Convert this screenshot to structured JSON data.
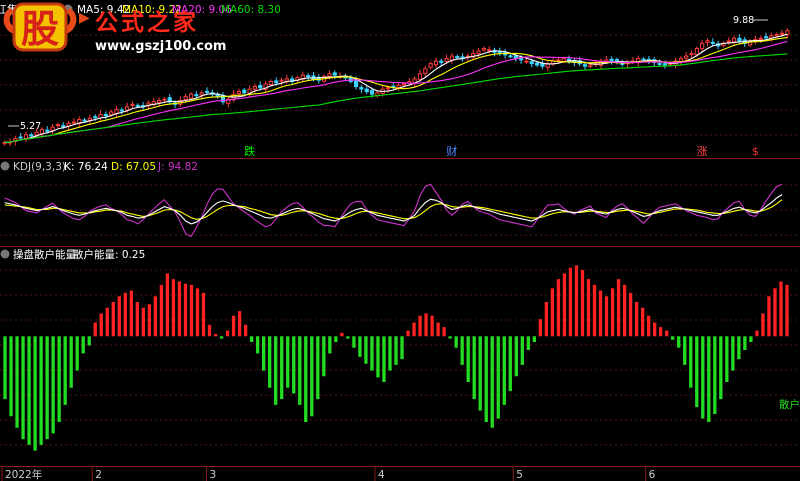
{
  "top_panel": {
    "title": "东江集团(日线)",
    "ma_labels": [
      {
        "text": "MA5: 9.42",
        "color": "#ffffff"
      },
      {
        "text": "MA10: 9.22",
        "color": "#ffff00"
      },
      {
        "text": "MA20: 9.06",
        "color": "#ff33ff"
      },
      {
        "text": "MA60: 8.30",
        "color": "#00dd00"
      }
    ],
    "high_label": "9.88",
    "low_label": "5.27",
    "signals": [
      {
        "text": "跌",
        "color": "#00ff00",
        "idx": 46
      },
      {
        "text": "财",
        "color": "#4d8cff",
        "idx": 84
      },
      {
        "text": "涨",
        "color": "#ff4444",
        "idx": 131
      },
      {
        "text": "$",
        "color": "#ff3333",
        "idx": 141
      }
    ]
  },
  "kdj_panel": {
    "title": "KDJ(9,3,3)",
    "k_label": "K: 76.24",
    "d_label": "D: 67.05",
    "j_label": "J: 94.82",
    "colors": {
      "k": "#ffffff",
      "d": "#ffff00",
      "j": "#cc33cc"
    }
  },
  "energy_panel": {
    "title": "操盘散户能量",
    "value_label": "散户能量: 0.25",
    "right_label": "散户",
    "colors": {
      "pos": "#ff2222",
      "neg": "#22dd22"
    }
  },
  "date_axis": {
    "labels": [
      {
        "text": "2022年",
        "idx": 0
      },
      {
        "text": "2",
        "idx": 15
      },
      {
        "text": "3",
        "idx": 34
      },
      {
        "text": "4",
        "idx": 62
      },
      {
        "text": "5",
        "idx": 85
      },
      {
        "text": "6",
        "idx": 107
      }
    ]
  },
  "watermark": {
    "icon_char": "股",
    "text": "公式之家",
    "url": "www.gszj100.com"
  },
  "chart_data": [
    {
      "type": "candlestick",
      "title": "东江集团(日线)",
      "ylim": [
        5.0,
        10.2
      ],
      "closes": [
        5.3,
        5.32,
        5.45,
        5.5,
        5.6,
        5.55,
        5.7,
        5.8,
        5.75,
        5.9,
        6.0,
        5.95,
        6.05,
        6.1,
        6.2,
        6.15,
        6.25,
        6.3,
        6.4,
        6.35,
        6.5,
        6.6,
        6.55,
        6.7,
        6.8,
        6.75,
        6.7,
        6.85,
        6.9,
        6.95,
        7.0,
        6.9,
        6.8,
        6.95,
        7.1,
        7.2,
        7.15,
        7.25,
        7.3,
        7.2,
        7.1,
        6.9,
        7.0,
        7.2,
        7.3,
        7.25,
        7.4,
        7.5,
        7.45,
        7.6,
        7.7,
        7.65,
        7.75,
        7.8,
        7.7,
        7.85,
        7.95,
        7.9,
        7.8,
        7.75,
        7.9,
        8.0,
        7.95,
        7.9,
        7.85,
        7.7,
        7.5,
        7.4,
        7.3,
        7.2,
        7.25,
        7.4,
        7.45,
        7.5,
        7.55,
        7.6,
        7.7,
        7.8,
        8.0,
        8.2,
        8.4,
        8.5,
        8.45,
        8.6,
        8.7,
        8.65,
        8.6,
        8.7,
        8.8,
        8.9,
        9.0,
        8.95,
        8.85,
        8.8,
        8.75,
        8.7,
        8.6,
        8.55,
        8.5,
        8.4,
        8.35,
        8.3,
        8.4,
        8.5,
        8.55,
        8.6,
        8.5,
        8.45,
        8.4,
        8.3,
        8.35,
        8.4,
        8.5,
        8.55,
        8.5,
        8.45,
        8.4,
        8.45,
        8.5,
        8.6,
        8.55,
        8.5,
        8.45,
        8.4,
        8.35,
        8.4,
        8.5,
        8.6,
        8.7,
        8.8,
        9.0,
        9.2,
        9.3,
        9.2,
        9.1,
        9.2,
        9.3,
        9.4,
        9.3,
        9.2,
        9.3,
        9.35,
        9.4,
        9.45,
        9.5,
        9.55,
        9.6,
        9.7
      ]
    },
    {
      "type": "line",
      "title": "KDJ(9,3,3)",
      "ylim": [
        -10,
        110
      ],
      "series": [
        {
          "name": "K",
          "values": [
            62,
            60,
            58,
            55,
            52,
            50,
            48,
            50,
            52,
            55,
            52,
            48,
            45,
            42,
            40,
            42,
            45,
            48,
            50,
            52,
            50,
            48,
            45,
            40,
            38,
            35,
            36,
            40,
            45,
            50,
            55,
            52,
            48,
            40,
            30,
            25,
            28,
            35,
            45,
            55,
            62,
            65,
            62,
            58,
            55,
            52,
            48,
            44,
            40,
            36,
            35,
            38,
            42,
            46,
            50,
            52,
            50,
            46,
            42,
            38,
            34,
            32,
            30,
            34,
            40,
            46,
            50,
            52,
            48,
            44,
            40,
            38,
            36,
            34,
            32,
            30,
            34,
            40,
            52,
            62,
            68,
            66,
            62,
            55,
            50,
            52,
            56,
            58,
            55,
            52,
            50,
            48,
            45,
            42,
            40,
            38,
            36,
            34,
            32,
            30,
            34,
            40,
            46,
            48,
            50,
            48,
            46,
            44,
            46,
            48,
            50,
            46,
            44,
            42,
            46,
            50,
            52,
            50,
            46,
            42,
            38,
            40,
            44,
            48,
            50,
            52,
            54,
            52,
            50,
            48,
            46,
            44,
            42,
            40,
            40,
            44,
            48,
            52,
            54,
            50,
            46,
            44,
            48,
            55,
            62,
            70,
            76
          ]
        },
        {
          "name": "D",
          "values": [
            58,
            57,
            56,
            55,
            54,
            52,
            50,
            50,
            50,
            52,
            52,
            50,
            48,
            46,
            44,
            44,
            44,
            46,
            47,
            49,
            49,
            48,
            47,
            44,
            42,
            40,
            38,
            39,
            42,
            45,
            49,
            50,
            49,
            46,
            41,
            36,
            33,
            34,
            38,
            44,
            50,
            55,
            57,
            57,
            56,
            55,
            52,
            50,
            47,
            44,
            41,
            40,
            40,
            42,
            45,
            47,
            48,
            47,
            45,
            43,
            40,
            37,
            35,
            34,
            36,
            39,
            43,
            46,
            47,
            46,
            44,
            42,
            40,
            38,
            36,
            34,
            34,
            36,
            41,
            48,
            55,
            59,
            60,
            58,
            55,
            54,
            54,
            55,
            55,
            54,
            53,
            51,
            49,
            47,
            45,
            43,
            41,
            39,
            37,
            35,
            35,
            37,
            40,
            43,
            45,
            46,
            46,
            45,
            45,
            46,
            47,
            47,
            46,
            45,
            45,
            47,
            48,
            49,
            48,
            46,
            44,
            42,
            43,
            45,
            47,
            49,
            51,
            51,
            51,
            50,
            49,
            47,
            45,
            44,
            43,
            43,
            45,
            47,
            49,
            50,
            49,
            47,
            47,
            50,
            54,
            60,
            67
          ]
        }
      ]
    },
    {
      "type": "bar",
      "title": "操盘散户能量",
      "ylim": [
        -1.1,
        0.65
      ],
      "values": [
        -0.55,
        -0.7,
        -0.8,
        -0.9,
        -0.95,
        -1.0,
        -0.95,
        -0.9,
        -0.85,
        -0.75,
        -0.6,
        -0.45,
        -0.3,
        -0.15,
        -0.08,
        0.12,
        0.2,
        0.25,
        0.3,
        0.35,
        0.38,
        0.4,
        0.3,
        0.25,
        0.28,
        0.35,
        0.45,
        0.55,
        0.5,
        0.48,
        0.46,
        0.45,
        0.42,
        0.38,
        0.1,
        0.02,
        -0.02,
        0.05,
        0.18,
        0.22,
        0.1,
        -0.05,
        -0.15,
        -0.3,
        -0.45,
        -0.6,
        -0.55,
        -0.45,
        -0.5,
        -0.6,
        -0.75,
        -0.7,
        -0.55,
        -0.35,
        -0.15,
        -0.05,
        0.03,
        -0.02,
        -0.1,
        -0.18,
        -0.24,
        -0.3,
        -0.36,
        -0.4,
        -0.3,
        -0.25,
        -0.2,
        0.05,
        0.12,
        0.18,
        0.2,
        0.18,
        0.12,
        0.08,
        -0.02,
        -0.1,
        -0.25,
        -0.4,
        -0.55,
        -0.65,
        -0.75,
        -0.8,
        -0.72,
        -0.6,
        -0.48,
        -0.35,
        -0.25,
        -0.12,
        -0.05,
        0.15,
        0.3,
        0.42,
        0.5,
        0.55,
        0.6,
        0.62,
        0.58,
        0.5,
        0.45,
        0.4,
        0.35,
        0.42,
        0.5,
        0.45,
        0.38,
        0.3,
        0.25,
        0.18,
        0.12,
        0.08,
        0.05,
        -0.03,
        -0.1,
        -0.25,
        -0.45,
        -0.62,
        -0.72,
        -0.75,
        -0.68,
        -0.55,
        -0.4,
        -0.3,
        -0.2,
        -0.12,
        -0.05,
        0.05,
        0.2,
        0.35,
        0.42,
        0.48,
        0.45
      ]
    }
  ]
}
